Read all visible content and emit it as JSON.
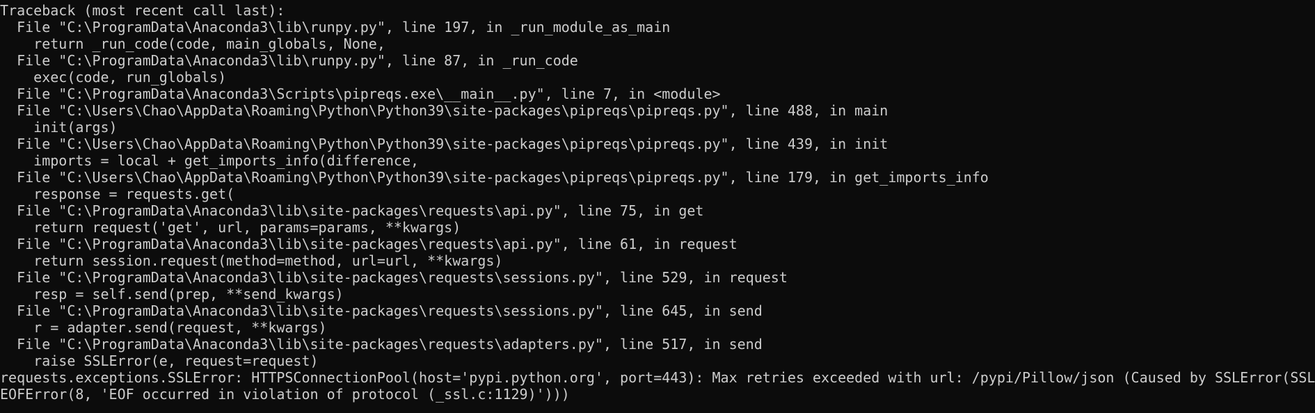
{
  "terminal": {
    "lines": [
      "Traceback (most recent call last):",
      "  File \"C:\\ProgramData\\Anaconda3\\lib\\runpy.py\", line 197, in _run_module_as_main",
      "    return _run_code(code, main_globals, None,",
      "  File \"C:\\ProgramData\\Anaconda3\\lib\\runpy.py\", line 87, in _run_code",
      "    exec(code, run_globals)",
      "  File \"C:\\ProgramData\\Anaconda3\\Scripts\\pipreqs.exe\\__main__.py\", line 7, in <module>",
      "  File \"C:\\Users\\Chao\\AppData\\Roaming\\Python\\Python39\\site-packages\\pipreqs\\pipreqs.py\", line 488, in main",
      "    init(args)",
      "  File \"C:\\Users\\Chao\\AppData\\Roaming\\Python\\Python39\\site-packages\\pipreqs\\pipreqs.py\", line 439, in init",
      "    imports = local + get_imports_info(difference,",
      "  File \"C:\\Users\\Chao\\AppData\\Roaming\\Python\\Python39\\site-packages\\pipreqs\\pipreqs.py\", line 179, in get_imports_info",
      "    response = requests.get(",
      "  File \"C:\\ProgramData\\Anaconda3\\lib\\site-packages\\requests\\api.py\", line 75, in get",
      "    return request('get', url, params=params, **kwargs)",
      "  File \"C:\\ProgramData\\Anaconda3\\lib\\site-packages\\requests\\api.py\", line 61, in request",
      "    return session.request(method=method, url=url, **kwargs)",
      "  File \"C:\\ProgramData\\Anaconda3\\lib\\site-packages\\requests\\sessions.py\", line 529, in request",
      "    resp = self.send(prep, **send_kwargs)",
      "  File \"C:\\ProgramData\\Anaconda3\\lib\\site-packages\\requests\\sessions.py\", line 645, in send",
      "    r = adapter.send(request, **kwargs)",
      "  File \"C:\\ProgramData\\Anaconda3\\lib\\site-packages\\requests\\adapters.py\", line 517, in send",
      "    raise SSLError(e, request=request)",
      "requests.exceptions.SSLError: HTTPSConnectionPool(host='pypi.python.org', port=443): Max retries exceeded with url: /pypi/Pillow/json (Caused by SSLError(SSL",
      "EOFError(8, 'EOF occurred in violation of protocol (_ssl.c:1129)')))"
    ]
  },
  "colors": {
    "background": "#0c0c0c",
    "text": "#cccccc"
  }
}
